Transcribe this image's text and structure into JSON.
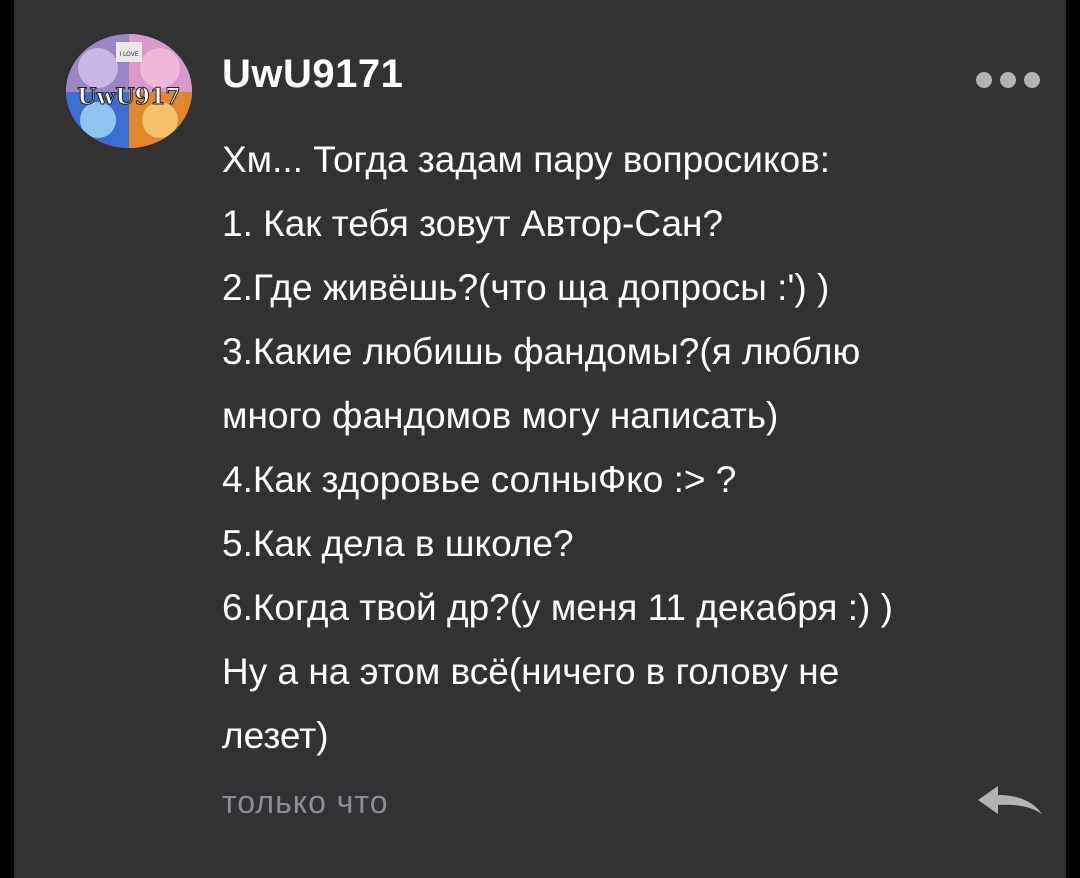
{
  "comment": {
    "username": "UwU9171",
    "lines": [
      "Хм... Тогда задам пару вопросиков:",
      "1. Как тебя зовут Автор-Сан?",
      "2.Где живёшь?(что ща допросы :') )",
      "3.Какие любишь фандомы?(я люблю",
      "много фандомов могу написать)",
      "4.Как здоровье солныФко :> ?",
      "5.Как дела в школе?",
      "6.Когда твой др?(у меня 11 декабря :) )",
      "Ну а на этом всё(ничего в голову не",
      "лезет)"
    ],
    "timestamp": "только что",
    "avatar_text": "UwU917",
    "avatar_badge": "I LOVE"
  },
  "icons": {
    "more": "more-dots-icon",
    "reply": "reply-arrow-icon"
  },
  "colors": {
    "card_background": "#323134",
    "outer_background": "#000000",
    "text": "#ffffff",
    "timestamp": "#8d8c91",
    "icon": "#b3b3b3"
  }
}
